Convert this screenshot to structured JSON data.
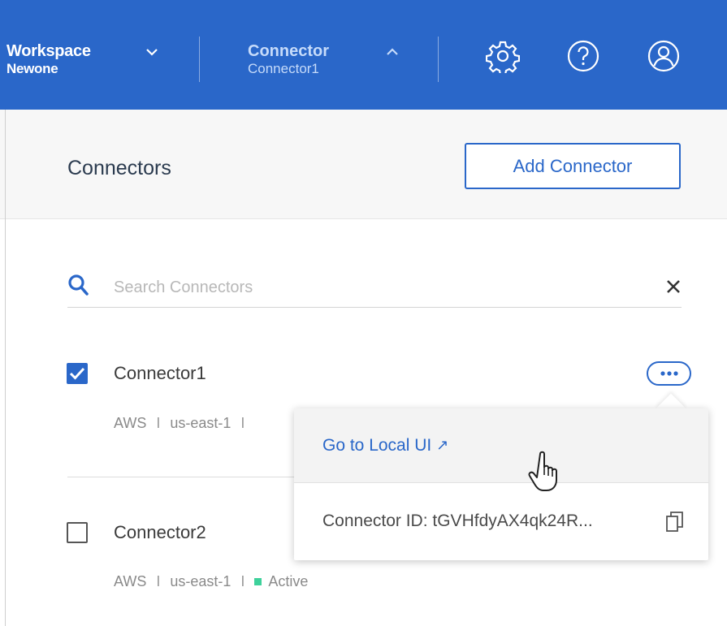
{
  "topbar": {
    "workspace_label": "Workspace",
    "workspace_value": "Newone",
    "connector_label": "Connector",
    "connector_value": "Connector1",
    "icons": [
      "settings-icon",
      "help-icon",
      "user-icon"
    ]
  },
  "panel": {
    "title": "Connectors",
    "add_button": "Add Connector"
  },
  "search": {
    "placeholder": "Search Connectors"
  },
  "connectors": [
    {
      "name": "Connector1",
      "provider": "AWS",
      "separator": "I",
      "region": "us-east-1",
      "checked": true
    },
    {
      "name": "Connector2",
      "provider": "AWS",
      "separator": "I",
      "region": "us-east-1",
      "status": "Active",
      "checked": false
    }
  ],
  "menu": {
    "go_local": "Go to Local UI",
    "go_local_arrow": "↗",
    "connector_id": "Connector ID: tGVHfdyAX4qk24R..."
  },
  "colors": {
    "brand": "#2a67c9",
    "active": "#3ed19b"
  }
}
